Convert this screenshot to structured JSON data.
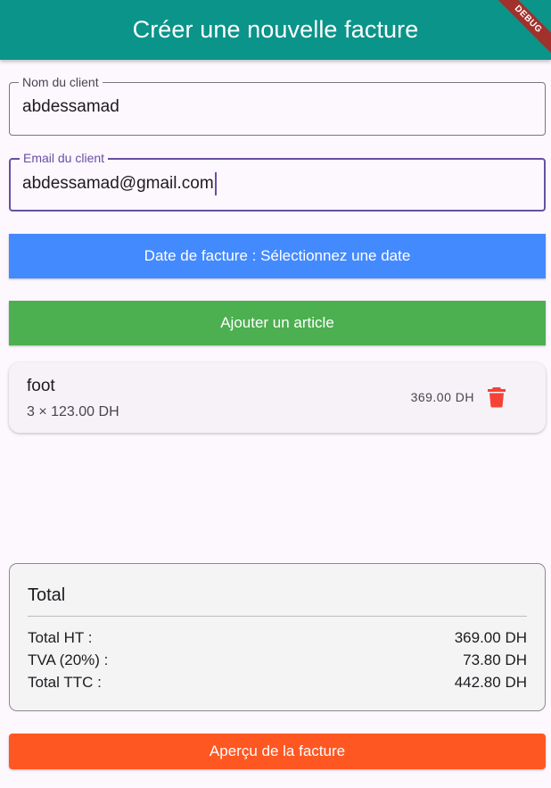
{
  "appbar": {
    "title": "Créer une nouvelle facture",
    "debug_label": "DEBUG",
    "color": "#0a948a"
  },
  "form": {
    "client_name": {
      "label": "Nom du client",
      "value": "abdessamad"
    },
    "client_email": {
      "label": "Email du client",
      "value": "abdessamad@gmail.com",
      "focused": true
    }
  },
  "buttons": {
    "date_label": "Date de facture : Sélectionnez une date",
    "add_article_label": "Ajouter un article",
    "preview_label": "Aperçu de la facture",
    "date_color": "#448aff",
    "add_color": "#4caf50",
    "preview_color": "#ff5722"
  },
  "articles": [
    {
      "name": "foot",
      "detail": "3 × 123.00 DH",
      "total": "369.00 DH",
      "action_icon": "trash-icon",
      "icon_color": "#f44336"
    }
  ],
  "totals": {
    "title": "Total",
    "ht_label": "Total HT :",
    "ht_value": "369.00 DH",
    "tva_label": "TVA (20%) :",
    "tva_value": "73.80 DH",
    "ttc_label": "Total TTC :",
    "ttc_value": "442.80 DH"
  }
}
